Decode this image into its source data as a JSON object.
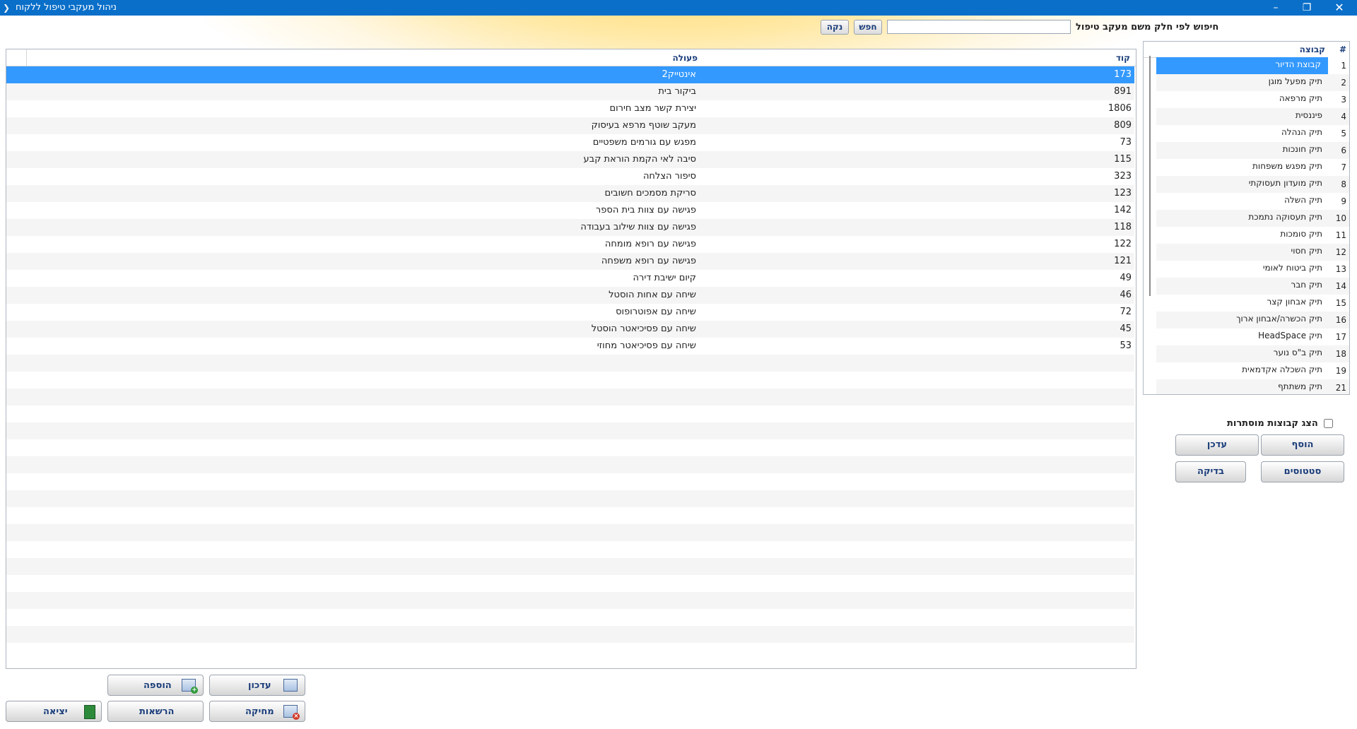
{
  "window": {
    "title": "ניהול מעקבי טיפול ללקוח",
    "restore_icon": "restore-icon",
    "close_icon": "close-icon"
  },
  "search": {
    "label": "חיפוש לפי חלק משם מעקב טיפול",
    "value": "",
    "search_button": "חפש",
    "clear_button": "נקה"
  },
  "grid": {
    "columns": {
      "action": "פעולה",
      "code": "קוד"
    },
    "rows": [
      {
        "code": "173",
        "action": "אינטייק2"
      },
      {
        "code": "891",
        "action": "ביקור בית"
      },
      {
        "code": "1806",
        "action": "יצירת קשר מצב חירום"
      },
      {
        "code": "809",
        "action": "מעקב שוטף מרפא בעיסוק"
      },
      {
        "code": "73",
        "action": "מפגש עם גורמים משפטיים"
      },
      {
        "code": "115",
        "action": "סיבה לאי הקמת הוראת קבע"
      },
      {
        "code": "323",
        "action": "סיפור הצלחה"
      },
      {
        "code": "123",
        "action": "סריקת מסמכים חשובים"
      },
      {
        "code": "142",
        "action": "פגישה עם צוות בית הספר"
      },
      {
        "code": "118",
        "action": "פגישה עם צוות שילוב בעבודה"
      },
      {
        "code": "122",
        "action": "פגישה עם רופא מומחה"
      },
      {
        "code": "121",
        "action": "פגישה עם רופא משפחה"
      },
      {
        "code": "49",
        "action": "קיום ישיבת דירה"
      },
      {
        "code": "46",
        "action": "שיחה עם אחות הוסטל"
      },
      {
        "code": "72",
        "action": "שיחה עם אפוטרופוס"
      },
      {
        "code": "45",
        "action": "שיחה עם פסיכיאטר הוסטל"
      },
      {
        "code": "53",
        "action": "שיחה עם פסיכיאטר מחוזי"
      }
    ],
    "selected_index": 0
  },
  "groups": {
    "columns": {
      "num": "#",
      "group": "קבוצה"
    },
    "items": [
      {
        "num": "1",
        "name": "קבוצת הדיור"
      },
      {
        "num": "2",
        "name": "תיק מפעל מוגן"
      },
      {
        "num": "3",
        "name": "תיק מרפאה"
      },
      {
        "num": "4",
        "name": "פיננסית"
      },
      {
        "num": "5",
        "name": "תיק הנהלה"
      },
      {
        "num": "6",
        "name": "תיק חונכות"
      },
      {
        "num": "7",
        "name": "תיק מפגש משפחות"
      },
      {
        "num": "8",
        "name": "תיק מועדון תעסוקתי"
      },
      {
        "num": "9",
        "name": "תיק השלה"
      },
      {
        "num": "10",
        "name": "תיק תעסוקה נתמכת"
      },
      {
        "num": "11",
        "name": "תיק סומכות"
      },
      {
        "num": "12",
        "name": "תיק חסוי"
      },
      {
        "num": "13",
        "name": "תיק ביטוח לאומי"
      },
      {
        "num": "14",
        "name": "תיק חבר"
      },
      {
        "num": "15",
        "name": "תיק אבחון קצר"
      },
      {
        "num": "16",
        "name": "תיק הכשרה/אבחון ארוך"
      },
      {
        "num": "17",
        "name": "תיק HeadSpace"
      },
      {
        "num": "18",
        "name": "תיק ב\"ס נוער"
      },
      {
        "num": "19",
        "name": "תיק השכלה אקדמאית"
      },
      {
        "num": "21",
        "name": "תיק משתתף"
      }
    ],
    "selected_index": 0,
    "show_hidden_label": "הצג קבוצות מוסתרות",
    "buttons": {
      "add": "הוסף",
      "update": "עדכן",
      "statuses": "סטטוסים",
      "check": "בדיקה"
    }
  },
  "bottom_buttons": {
    "update": "עדכון",
    "add": "הוספה",
    "delete": "מחיקה",
    "permissions": "הרשאות",
    "exit": "יציאה"
  }
}
